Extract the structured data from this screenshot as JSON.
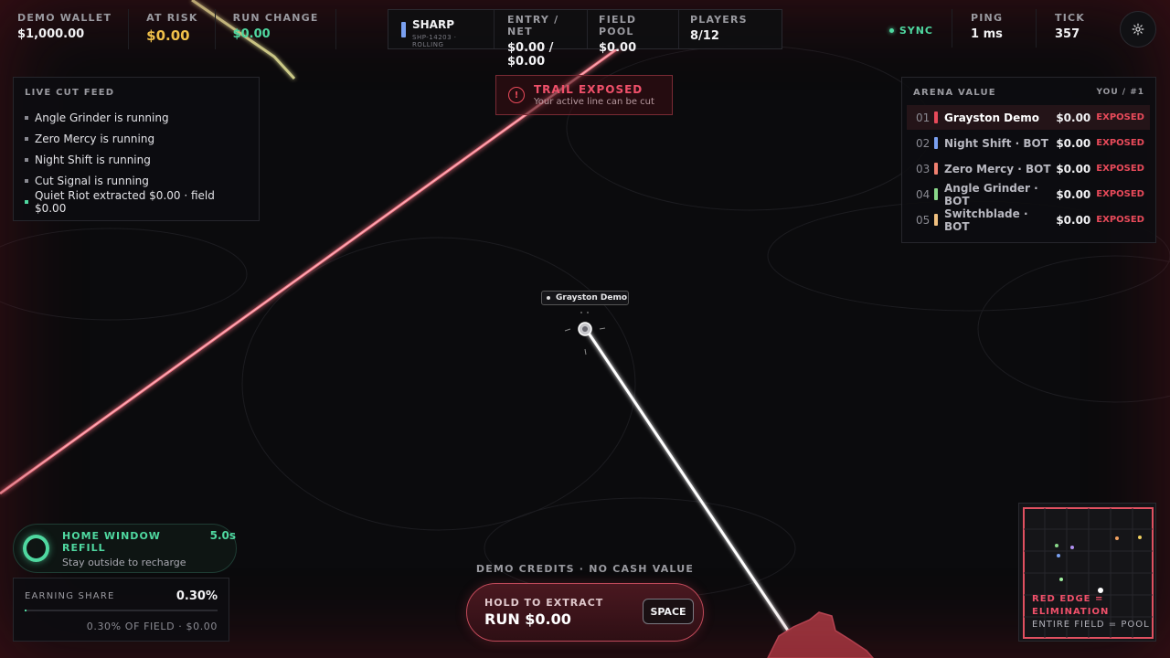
{
  "top_stats": [
    {
      "label": "DEMO WALLET",
      "value": "$1,000.00"
    },
    {
      "label": "AT RISK",
      "value": "$0.00"
    },
    {
      "label": "RUN CHANGE",
      "value": "$0.00"
    }
  ],
  "center_hud": {
    "mode_name": "SHARP",
    "mode_sub": "SHP-14203 · ROLLING",
    "mode_color": "#7aa0f0",
    "entry_label": "ENTRY / NET",
    "entry_value": "$0.00 / $0.00",
    "pool_label": "FIELD POOL",
    "pool_value": "$0.00",
    "players_label": "PLAYERS",
    "players_value": "8/12"
  },
  "top_right": {
    "sync_label": "SYNC",
    "ping_label": "PING",
    "ping_value": "1 ms",
    "tick_label": "TICK",
    "tick_value": "357",
    "settings_icon": "gear-icon"
  },
  "alert": {
    "icon": "!",
    "title": "TRAIL EXPOSED",
    "subtitle": "Your active line can be cut"
  },
  "feed": {
    "title": "LIVE CUT FEED",
    "items": [
      {
        "text": "Angle Grinder is running",
        "highlight": false
      },
      {
        "text": "Zero Mercy is running",
        "highlight": false
      },
      {
        "text": "Night Shift is running",
        "highlight": false
      },
      {
        "text": "Cut Signal is running",
        "highlight": false
      },
      {
        "text": "Quiet Riot extracted $0.00 · field $0.00",
        "highlight": true
      }
    ]
  },
  "arena_value": {
    "title": "ARENA VALUE",
    "you_rank": "YOU / #1",
    "rows": [
      {
        "rank": "01",
        "name": "Grayston Demo",
        "amount": "$0.00",
        "status": "EXPOSED",
        "color": "#e84a5a",
        "me": true
      },
      {
        "rank": "02",
        "name": "Night Shift · BOT",
        "amount": "$0.00",
        "status": "EXPOSED",
        "color": "#7aa0f0",
        "me": false
      },
      {
        "rank": "03",
        "name": "Zero Mercy · BOT",
        "amount": "$0.00",
        "status": "EXPOSED",
        "color": "#f08070",
        "me": false
      },
      {
        "rank": "04",
        "name": "Angle Grinder · BOT",
        "amount": "$0.00",
        "status": "EXPOSED",
        "color": "#8ad88a",
        "me": false
      },
      {
        "rank": "05",
        "name": "Switchblade · BOT",
        "amount": "$0.00",
        "status": "EXPOSED",
        "color": "#f0c080",
        "me": false
      }
    ]
  },
  "player": {
    "name": "Grayston Demo"
  },
  "refill": {
    "title": "HOME WINDOW REFILL",
    "time": "5.0s",
    "subtitle": "Stay outside to recharge"
  },
  "earning": {
    "label": "EARNING SHARE",
    "percent": "0.30%",
    "fill_fraction": 0.003,
    "subtitle": "0.30% OF FIELD · $0.00"
  },
  "extract": {
    "credits_note": "DEMO CREDITS · NO CASH VALUE",
    "title": "HOLD TO EXTRACT",
    "run_value": "RUN $0.00",
    "key": "SPACE"
  },
  "minimap": {
    "warning": "RED EDGE = ELIMINATION",
    "note": "ENTIRE FIELD = POOL"
  }
}
